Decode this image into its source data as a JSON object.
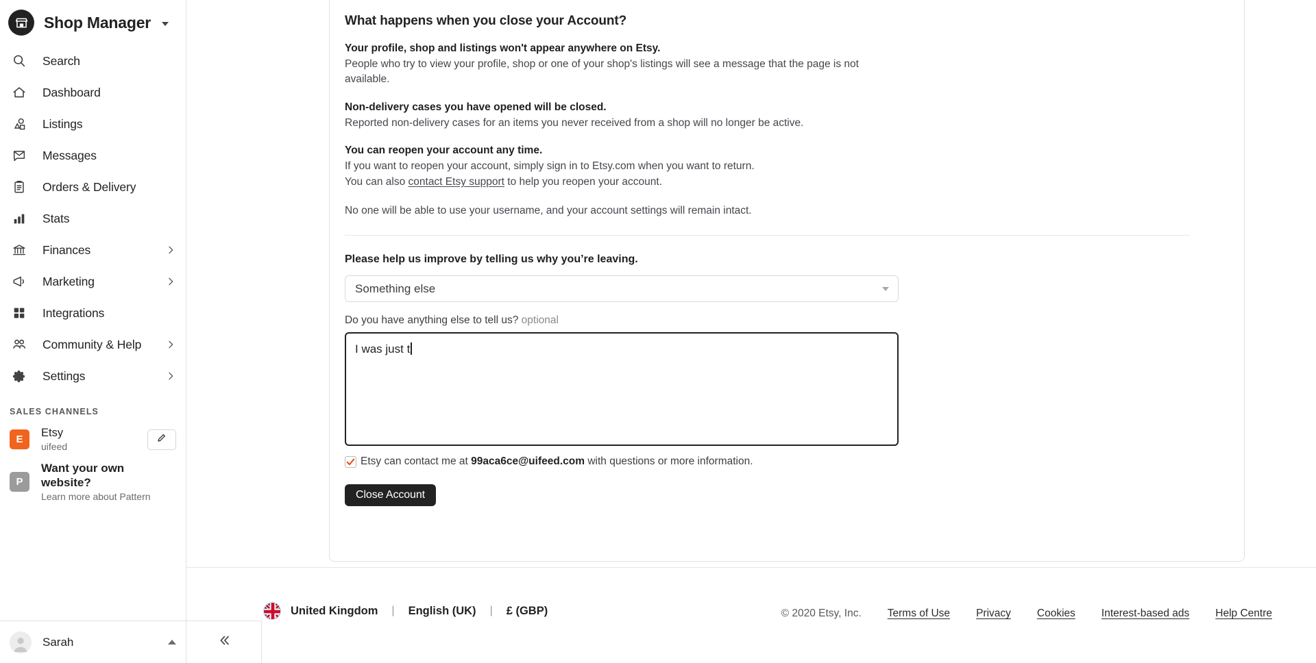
{
  "sidebar": {
    "brand": {
      "title": "Shop Manager",
      "logo_icon": "shop-icon",
      "caret_icon": "caret-down-icon"
    },
    "items": [
      {
        "label": "Search",
        "icon": "search-icon",
        "chevron": false
      },
      {
        "label": "Dashboard",
        "icon": "home-icon",
        "chevron": false
      },
      {
        "label": "Listings",
        "icon": "shapes-icon",
        "chevron": false
      },
      {
        "label": "Messages",
        "icon": "envelope-icon",
        "chevron": false
      },
      {
        "label": "Orders & Delivery",
        "icon": "clipboard-icon",
        "chevron": false
      },
      {
        "label": "Stats",
        "icon": "bar-chart-icon",
        "chevron": false
      },
      {
        "label": "Finances",
        "icon": "bank-icon",
        "chevron": true
      },
      {
        "label": "Marketing",
        "icon": "megaphone-icon",
        "chevron": true
      },
      {
        "label": "Integrations",
        "icon": "grid-icon",
        "chevron": false
      },
      {
        "label": "Community & Help",
        "icon": "people-icon",
        "chevron": true
      },
      {
        "label": "Settings",
        "icon": "gear-icon",
        "chevron": true
      }
    ],
    "sales_channels_label": "SALES CHANNELS",
    "channels": [
      {
        "badge": "E",
        "badge_color": "#f1641e",
        "title": "Etsy",
        "subtitle": "uifeed",
        "has_edit": true,
        "edit_icon": "pencil-icon"
      },
      {
        "badge": "P",
        "badge_color": "#9b9b9b",
        "title": "Want your own website?",
        "subtitle": "Learn more about Pattern",
        "has_edit": false
      }
    ],
    "user": {
      "name": "Sarah",
      "avatar_icon": "avatar-icon",
      "caret_icon": "caret-up-icon"
    },
    "collapse_icon": "double-chevron-left-icon"
  },
  "main": {
    "heading": "What happens when you close your Account?",
    "blocks": [
      {
        "title": "Your profile, shop and listings won't appear anywhere on Etsy.",
        "body": "People who try to view your profile, shop or one of your shop's listings will see a message that the page is not available."
      },
      {
        "title": "Non-delivery cases you have opened will be closed.",
        "body": "Reported non-delivery cases for an items you never received from a shop will no longer be active."
      }
    ],
    "reopen": {
      "title": "You can reopen your account any time.",
      "line1": "If you want to reopen your account, simply sign in to Etsy.com when you want to return.",
      "line2_pre": "You can also ",
      "line2_link": "contact Etsy support",
      "line2_post": " to help you reopen your account."
    },
    "note": "No one will be able to use your username, and your account settings will remain intact.",
    "prompt": "Please help us improve by telling us why you’re leaving.",
    "reason_select": {
      "value": "Something else",
      "caret_icon": "select-caret-icon"
    },
    "feedback": {
      "label": "Do you have anything else to tell us?",
      "optional": "optional",
      "value": "I was just t",
      "placeholder": ""
    },
    "consent": {
      "checked": true,
      "pre": "Etsy can contact me at ",
      "email": "99aca6ce@uifeed.com",
      "post": " with questions or more information."
    },
    "close_button": "Close Account"
  },
  "footer": {
    "flag_icon": "uk-flag-icon",
    "country": "United Kingdom",
    "separator": "|",
    "language": "English (UK)",
    "currency": "£ (GBP)",
    "copyright": "© 2020 Etsy, Inc.",
    "links": [
      "Terms of Use",
      "Privacy",
      "Cookies",
      "Interest-based ads",
      "Help Centre"
    ]
  },
  "colors": {
    "etsy_orange": "#f1641e",
    "button_dark": "#222222",
    "border": "#e1e3df"
  }
}
